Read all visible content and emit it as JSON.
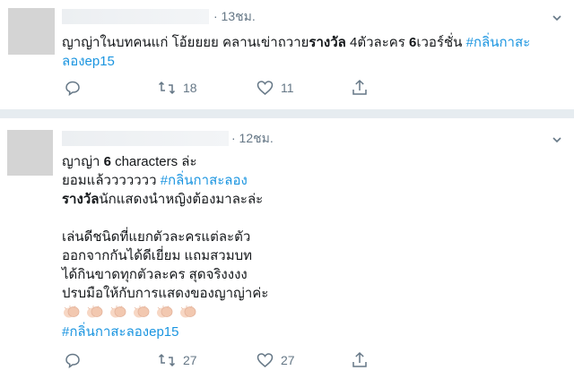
{
  "tweet1": {
    "time": "· 13ชม.",
    "text_line1_plain": "ญาญ่าในบทคนแก่ โอ้ยยยย คลานเข่าถวาย",
    "text_line1_bold1": "รางวัล",
    "text_line1_mid": " 4ตัวละคร ",
    "text_line1_bold2": "6",
    "text_line1_end": "เวอร์ชั่น ",
    "hashtag_part1": "#กลิ่นกาสะ",
    "hashtag_part2": "ลองep15",
    "reply_count": "",
    "retweet_count": "18",
    "like_count": "11"
  },
  "tweet2": {
    "time": "· 12ชม.",
    "line1_a": "ญาญ่า ",
    "line1_b": "6",
    "line1_c": " characters ล่ะ",
    "line2_plain": "ยอมแล้ววววววว ",
    "line2_tag": "#กลิ่นกาสะลอง",
    "line3_bold": "รางวัล",
    "line3_rest": "นักแสดงนำหญิงต้องมาละล่ะ",
    "line4": "เล่นดีชนิดที่แยกตัวละครแต่ละตัว",
    "line5": "ออกจากกันได้ดีเยี่ยม แถมสวมบท",
    "line6": "ได้กินขาดทุกตัวละคร สุดจริงงงง",
    "line7": "ปรบมือให้กับการแสดงของญาญ่าค่ะ",
    "hashtag": "#กลิ่นกาสะลองep15",
    "retweet_count": "27",
    "like_count": "27"
  },
  "icons": {
    "reply": "reply-icon",
    "retweet": "retweet-icon",
    "like": "heart-icon",
    "share": "share-icon",
    "caret": "chevron-down-icon",
    "clap": "clapping-hands-emoji"
  },
  "colors": {
    "hashtag": "#1b95e0",
    "secondary": "#657786",
    "divider": "#e6ecf0"
  }
}
